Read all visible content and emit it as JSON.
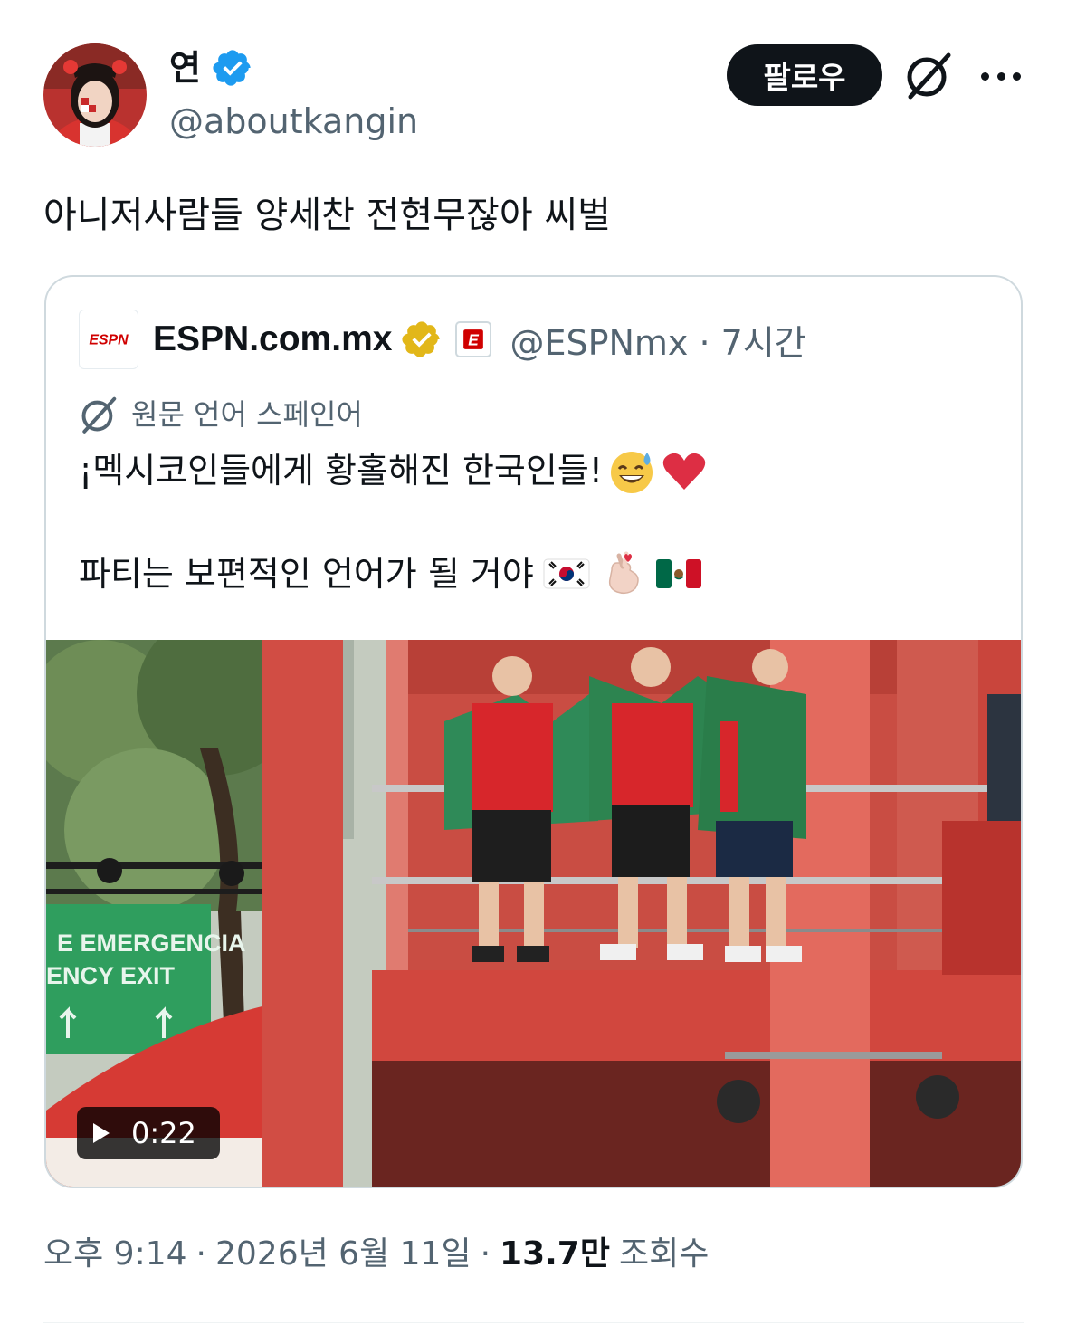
{
  "author": {
    "name": "연",
    "handle": "@aboutkangin",
    "verified": "blue"
  },
  "follow_label": "팔로우",
  "tweet_text": "아니저사람들 양세찬 전현무잖아 씨벌",
  "quote": {
    "name": "ESPN.com.mx",
    "logo_text": "ESPN",
    "verified": "gold",
    "affiliate_badge": "E",
    "handle_time": "@ESPNmx · 7시간",
    "translation_note": "원문 언어 스페인어",
    "line1": "¡멕시코인들에게 황홀해진 한국인들!",
    "line1_emojis": [
      "sweat-smile-emoji",
      "red-heart-emoji"
    ],
    "line2": "파티는 보편적인 언어가 될 거야",
    "line2_emojis": [
      "korea-flag-emoji",
      "finger-heart-emoji",
      "mexico-flag-emoji"
    ],
    "media": {
      "sign_line1": "E EMERGENCIA",
      "sign_line2": "ENCY EXIT",
      "video_duration": "0:22"
    }
  },
  "meta": {
    "time": "오후 9:14",
    "sep1": "·",
    "date": "2026년 6월 11일",
    "sep2": "·",
    "views_count": "13.7만",
    "views_label": "조회수"
  },
  "colors": {
    "text": "#0f1419",
    "secondary": "#536471",
    "verified_blue": "#1d9bf0",
    "verified_gold": "#e2b719",
    "espn_red": "#d00000",
    "border": "#cfd9de"
  }
}
